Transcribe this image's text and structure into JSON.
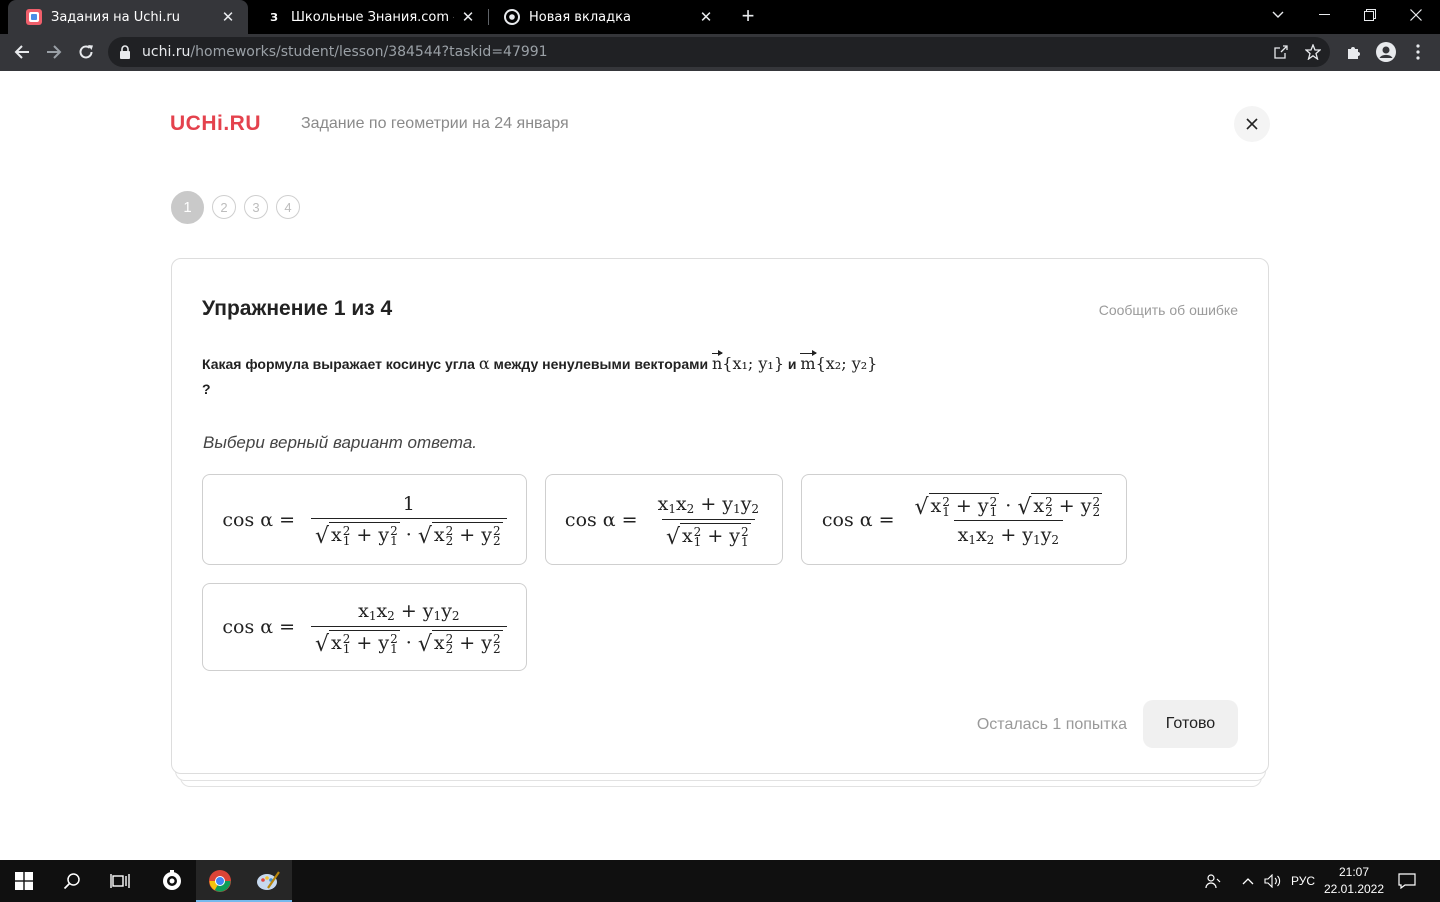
{
  "browser": {
    "tabs": [
      {
        "title": "Задания на Uchi.ru",
        "favicon": "uchi-favicon",
        "active": true
      },
      {
        "title": "Школьные Знания.com - Решае",
        "favicon": "znanija-favicon",
        "favicon_text": "З",
        "active": false
      },
      {
        "title": "Новая вкладка",
        "favicon": "chrome-favicon",
        "active": false
      }
    ],
    "url_host": "uchi.ru",
    "url_path": "/homeworks/student/lesson/384544?taskid=47991"
  },
  "header": {
    "logo": "UCHi.RU",
    "task_title": "Задание по геометрии на 24 января"
  },
  "steps": [
    "1",
    "2",
    "3",
    "4"
  ],
  "exercise": {
    "title": "Упражнение 1 из 4",
    "report_link": "Сообщить об ошибке",
    "question_text_1": "Какая формула выражает косинус угла",
    "question_alpha": "α",
    "question_text_2": "между ненулевыми векторами",
    "vec_n": "n",
    "coords_n": "{x₁; y₁}",
    "question_and": "и",
    "vec_m": "m",
    "coords_m": "{x₂; y₂}",
    "question_end": "?",
    "hint": "Выбери верный вариант ответа."
  },
  "footer": {
    "attempts": "Осталась 1 попытка",
    "done_button": "Готово"
  },
  "taskbar": {
    "language": "РУС",
    "time": "21:07",
    "date": "22.01.2022"
  }
}
